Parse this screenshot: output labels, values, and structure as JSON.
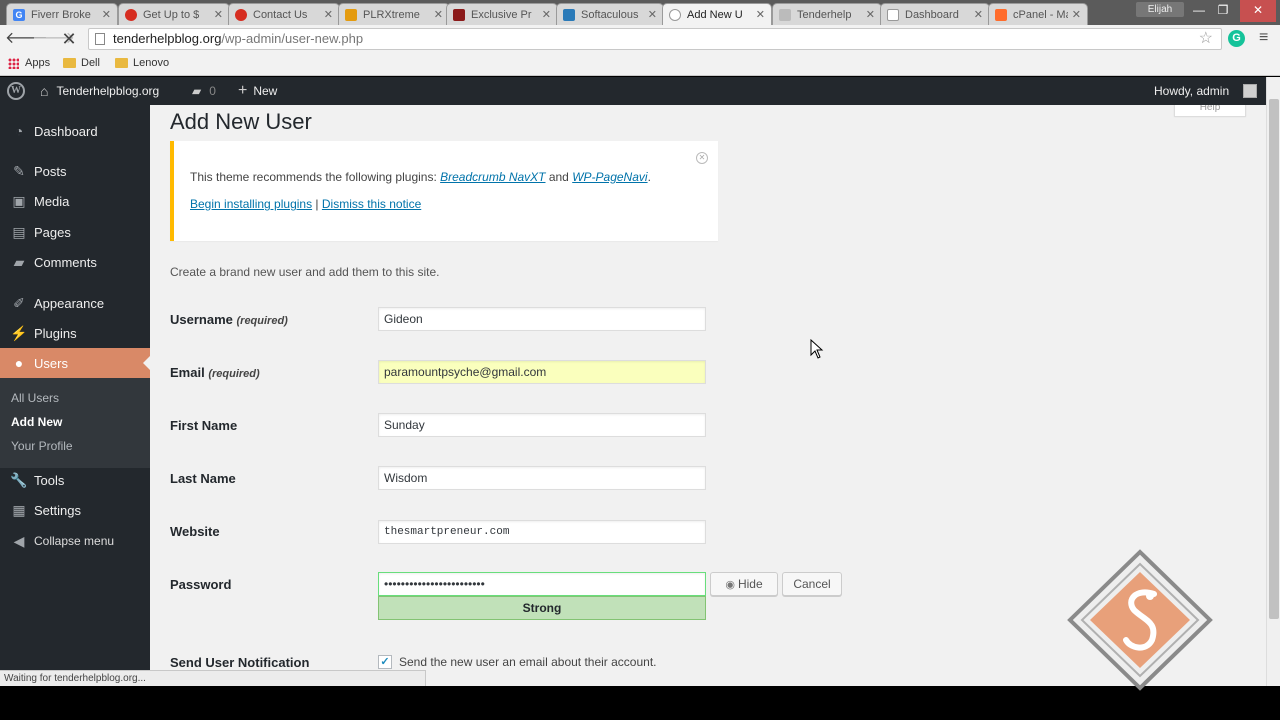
{
  "browser": {
    "tabs": [
      {
        "label": "Fiverr Broke",
        "color": "#4285f4",
        "glyph": "G"
      },
      {
        "label": "Get Up to $",
        "color": "#d62d20",
        "glyph": "●"
      },
      {
        "label": "Contact Us",
        "color": "#d62d20",
        "glyph": "●"
      },
      {
        "label": "PLRXtreme",
        "color": "#e49b0f",
        "glyph": "▣"
      },
      {
        "label": "Exclusive Pr",
        "color": "#8b1a1a",
        "glyph": "▮"
      },
      {
        "label": "Softaculous",
        "color": "#2a7ab8",
        "glyph": "~"
      },
      {
        "label": "Add New U",
        "color": "#888888",
        "glyph": "◠"
      },
      {
        "label": "Tenderhelp",
        "color": "#777777",
        "glyph": "~"
      },
      {
        "label": "Dashboard",
        "color": "#999999",
        "glyph": "▯"
      },
      {
        "label": "cPanel - Ma",
        "color": "#ff6c2c",
        "glyph": "cP"
      }
    ],
    "profile_name": "Elijah",
    "url_host": "tenderhelpblog.org",
    "url_path": "/wp-admin/user-new.php",
    "bookmarks": [
      "Apps",
      "Dell",
      "Lenovo"
    ],
    "status_text": "Waiting for tenderhelpblog.org..."
  },
  "adminbar": {
    "site_name": "Tenderhelpblog.org",
    "comments_count": "0",
    "new_label": "New",
    "greeting": "Howdy, admin"
  },
  "sidebar": {
    "items": [
      {
        "label": "Dashboard",
        "icon": "dashboard-icon"
      },
      {
        "label": "Posts",
        "icon": "pin-icon"
      },
      {
        "label": "Media",
        "icon": "media-icon"
      },
      {
        "label": "Pages",
        "icon": "page-icon"
      },
      {
        "label": "Comments",
        "icon": "comment-icon"
      },
      {
        "label": "Appearance",
        "icon": "brush-icon"
      },
      {
        "label": "Plugins",
        "icon": "plug-icon"
      },
      {
        "label": "Users",
        "icon": "user-icon"
      },
      {
        "label": "Tools",
        "icon": "wrench-icon"
      },
      {
        "label": "Settings",
        "icon": "settings-icon"
      },
      {
        "label": "Collapse menu",
        "icon": "collapse-icon"
      }
    ],
    "submenu": [
      "All Users",
      "Add New",
      "Your Profile"
    ]
  },
  "main": {
    "help_label": "Help",
    "title": "Add New User",
    "notice": {
      "text_before": "This theme recommends the following plugins: ",
      "plugin1": "Breadcrumb NavXT",
      "and": " and ",
      "plugin2": "WP-PageNavi",
      "period": ".",
      "install_link": "Begin installing plugins",
      "separator": " | ",
      "dismiss_link": "Dismiss this notice"
    },
    "intro": "Create a brand new user and add them to this site.",
    "fields": {
      "username_label": "Username",
      "required": "(required)",
      "username_value": "Gideon",
      "email_label": "Email",
      "email_value": "paramountpsyche@gmail.com",
      "first_name_label": "First Name",
      "first_name_value": "Sunday",
      "last_name_label": "Last Name",
      "last_name_value": "Wisdom",
      "website_label": "Website",
      "website_value": "thesmartpreneur.com",
      "password_label": "Password",
      "password_value": "••••••••••••••••••••••••",
      "password_strength": "Strong",
      "hide_label": "Hide",
      "cancel_label": "Cancel",
      "notification_label": "Send User Notification",
      "notification_text": "Send the new user an email about their account."
    }
  }
}
